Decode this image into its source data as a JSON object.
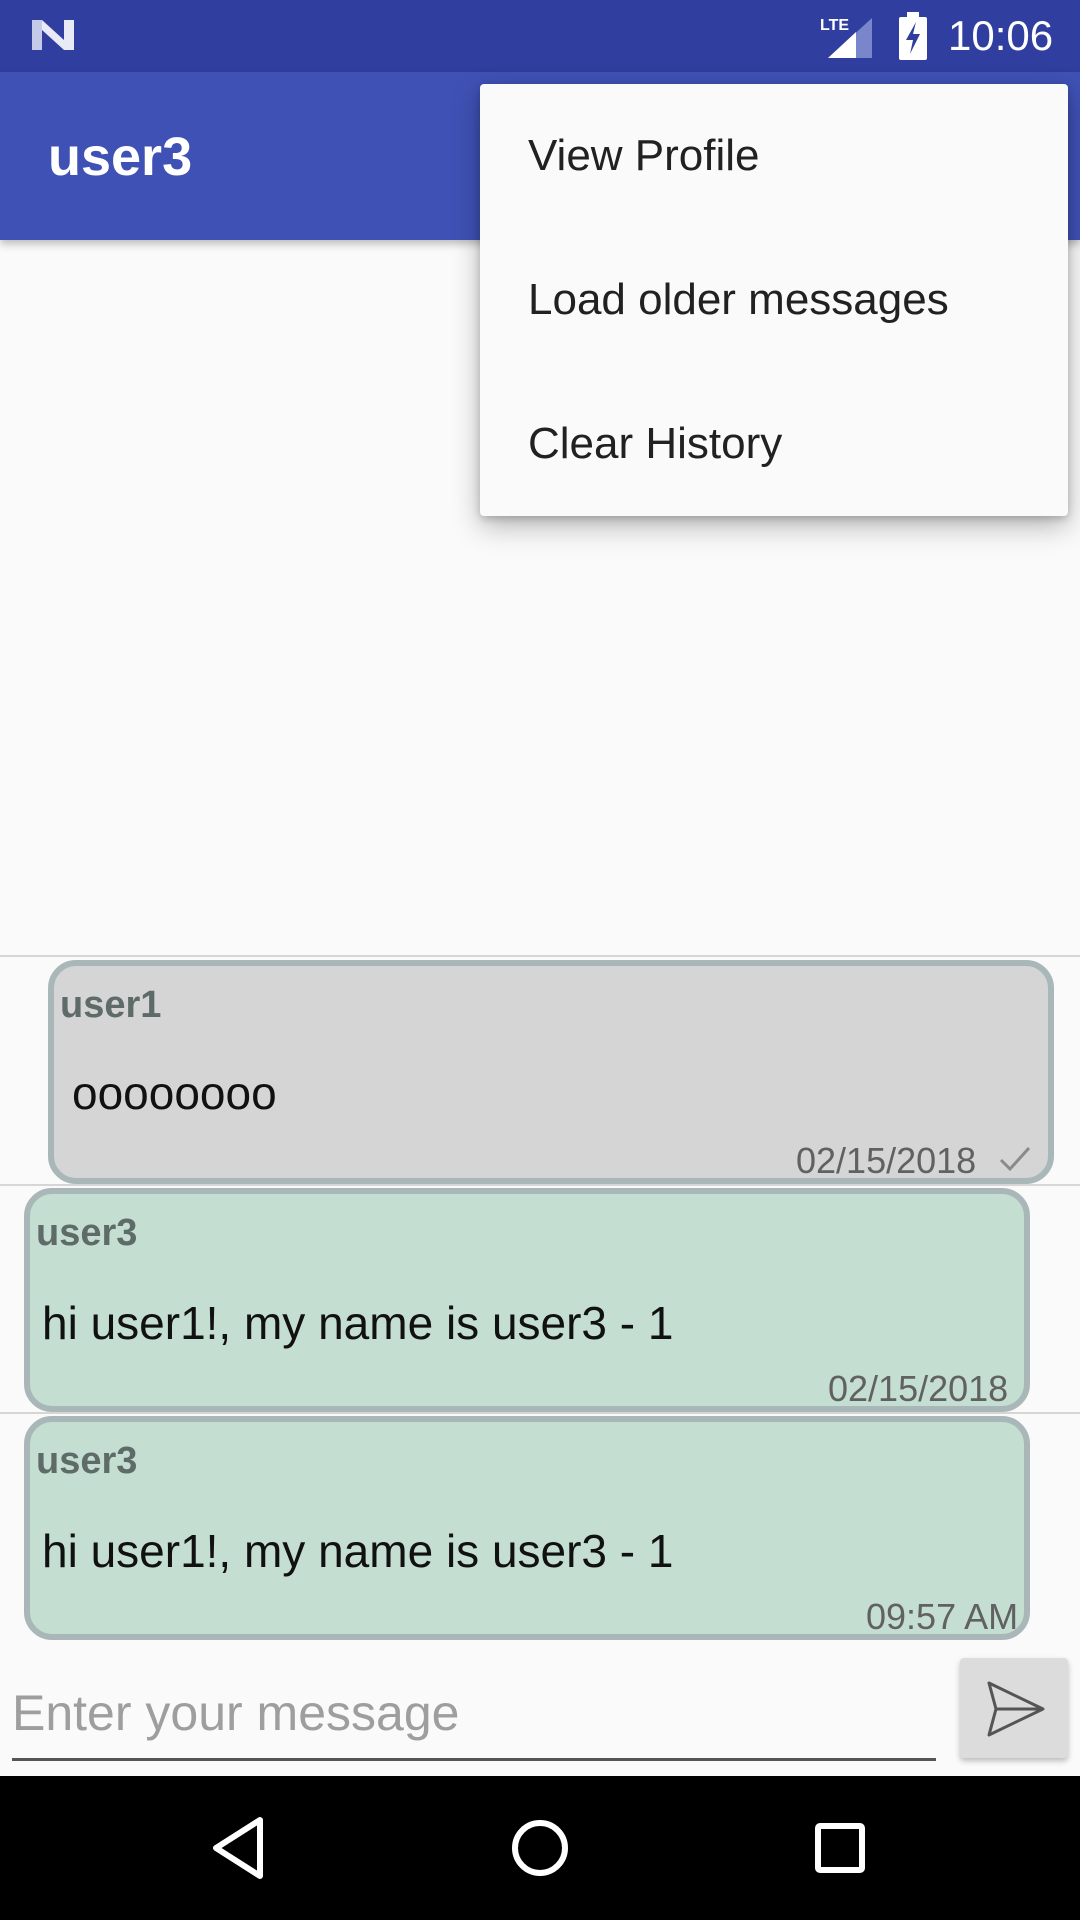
{
  "status_bar": {
    "network": "LTE",
    "time": "10:06",
    "icons": [
      "android-n-icon",
      "lte-signal-icon",
      "battery-charging-icon"
    ]
  },
  "app_bar": {
    "title": "user3",
    "background": "#3f51b5",
    "status_background": "#303f9f"
  },
  "overflow_menu": {
    "items": [
      {
        "label": "View Profile"
      },
      {
        "label": "Load older messages"
      },
      {
        "label": "Clear History"
      }
    ]
  },
  "messages": [
    {
      "sender": "user1",
      "text": "oooooooo",
      "time": "02/15/2018",
      "status_icon": "check-icon",
      "bubble_color": "#d5d5d5"
    },
    {
      "sender": "user3",
      "text": "hi user1!, my name is user3 - 1",
      "time": "02/15/2018",
      "bubble_color": "#c4ded2"
    },
    {
      "sender": "user3",
      "text": "hi user1!, my name is user3 - 1",
      "time": "09:57 AM",
      "bubble_color": "#c4ded2"
    }
  ],
  "composer": {
    "placeholder": "Enter your message",
    "value": "",
    "send_icon": "send-icon"
  },
  "nav_bar": {
    "icons": [
      "back-icon",
      "home-icon",
      "recents-icon"
    ]
  }
}
